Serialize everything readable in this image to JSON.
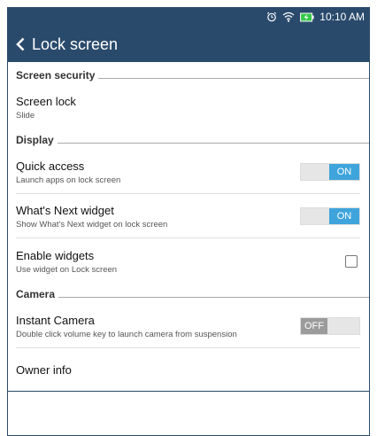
{
  "status_bar": {
    "time": "10:10 AM",
    "icons": [
      "alarm-icon",
      "wifi-icon",
      "battery-charging-icon"
    ]
  },
  "header": {
    "back_icon": "chevron-left-icon",
    "title": "Lock screen"
  },
  "sections": {
    "screen_security": "Screen security",
    "display": "Display",
    "camera": "Camera"
  },
  "items": {
    "screen_lock": {
      "title": "Screen lock",
      "subtitle": "Slide"
    },
    "quick_access": {
      "title": "Quick access",
      "subtitle": "Launch apps on lock screen",
      "toggle": "ON"
    },
    "whats_next": {
      "title": "What's Next widget",
      "subtitle": "Show What's Next widget on lock screen",
      "toggle": "ON"
    },
    "enable_widgets": {
      "title": "Enable widgets",
      "subtitle": "Use widget on Lock screen",
      "checked": false
    },
    "instant_camera": {
      "title": "Instant Camera",
      "subtitle": "Double click volume key to launch camera from suspension",
      "toggle": "OFF"
    },
    "owner_info": {
      "title": "Owner info"
    }
  },
  "colors": {
    "bar": "#2a4a6c",
    "accent_on": "#3fa4dc",
    "off": "#9b9b9b"
  }
}
